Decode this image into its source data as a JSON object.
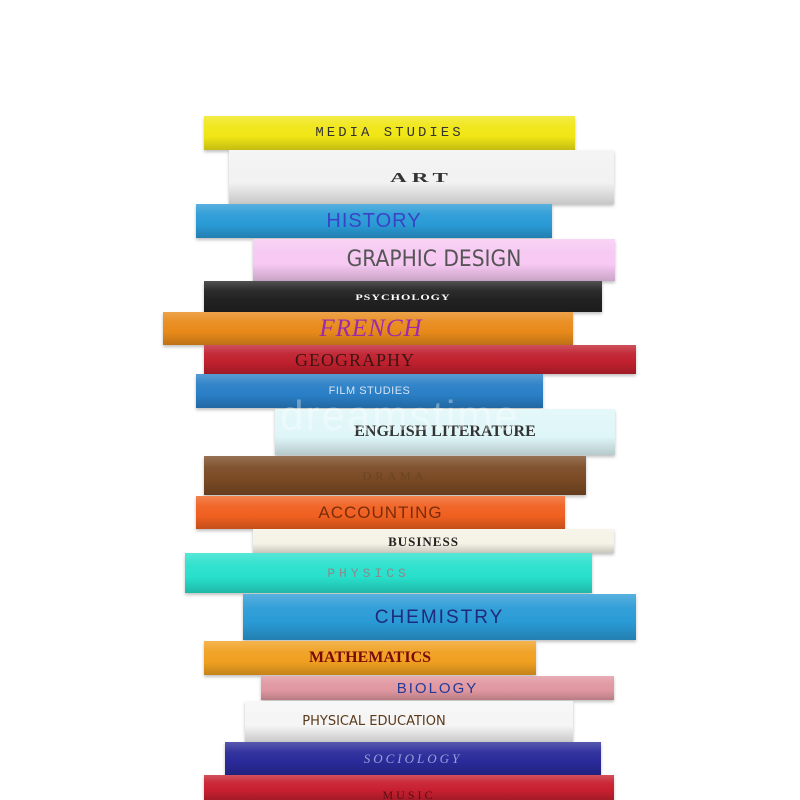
{
  "books": [
    {
      "label": "MEDIA STUDIES",
      "color": "#f0e615"
    },
    {
      "label": "ART",
      "color": "#f2f2f2"
    },
    {
      "label": "HISTORY",
      "color": "#2a9bd6"
    },
    {
      "label": "GRAPHIC DESIGN",
      "color": "#f6c8f2"
    },
    {
      "label": "PSYCHOLOGY",
      "color": "#222222"
    },
    {
      "label": "FRENCH",
      "color": "#e88a1a"
    },
    {
      "label": "GEOGRAPHY",
      "color": "#c0202e"
    },
    {
      "label": "FILM STUDIES",
      "color": "#2a7fc6"
    },
    {
      "label": "ENGLISH LITERATURE",
      "color": "#dff6f8"
    },
    {
      "label": "DRAMA",
      "color": "#7a4a24"
    },
    {
      "label": "ACCOUNTING",
      "color": "#f06020"
    },
    {
      "label": "BUSINESS",
      "color": "#f5f3e6"
    },
    {
      "label": "PHYSICS",
      "color": "#28e0cc"
    },
    {
      "label": "CHEMISTRY",
      "color": "#2a9bd6"
    },
    {
      "label": "MATHEMATICS",
      "color": "#f0a020"
    },
    {
      "label": "BIOLOGY",
      "color": "#e097a0"
    },
    {
      "label": "PHYSICAL EDUCATION",
      "color": "#f5f5f5"
    },
    {
      "label": "SOCIOLOGY",
      "color": "#2a2a9a"
    },
    {
      "label": "MUSIC",
      "color": "#c82030"
    }
  ],
  "watermark": "dreamstime"
}
